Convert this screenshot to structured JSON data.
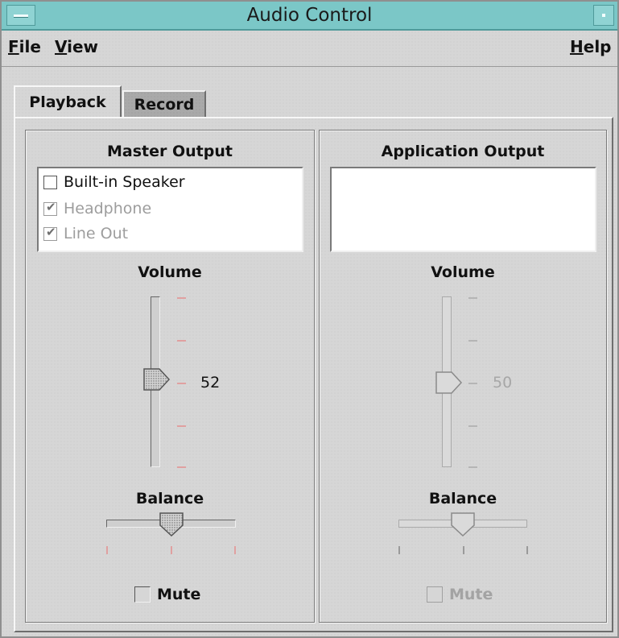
{
  "window": {
    "title": "Audio Control"
  },
  "menubar": {
    "file": {
      "mnemonic": "F",
      "rest": "ile"
    },
    "view": {
      "mnemonic": "V",
      "rest": "iew"
    },
    "help": {
      "mnemonic": "H",
      "rest": "elp"
    }
  },
  "tabs": [
    {
      "label": "Playback",
      "selected": true
    },
    {
      "label": "Record",
      "selected": false
    }
  ],
  "master": {
    "heading": "Master Output",
    "outputs": [
      {
        "label": "Built-in Speaker",
        "checked": false,
        "enabled": true
      },
      {
        "label": "Headphone",
        "checked": true,
        "enabled": false
      },
      {
        "label": "Line Out",
        "checked": true,
        "enabled": false
      }
    ],
    "volume_label": "Volume",
    "volume_value": "52",
    "volume_level": 0.52,
    "balance_label": "Balance",
    "balance_level": 0.5,
    "mute_label": "Mute",
    "mute_checked": false
  },
  "application": {
    "heading": "Application Output",
    "volume_label": "Volume",
    "volume_value": "50",
    "volume_level": 0.5,
    "balance_label": "Balance",
    "balance_level": 0.5,
    "mute_label": "Mute",
    "mute_checked": false,
    "enabled": false
  },
  "colors": {
    "titlebar": "#7bc7c7",
    "tick_active": "#e0a0a0",
    "tick_disabled": "#b5b5b5"
  }
}
